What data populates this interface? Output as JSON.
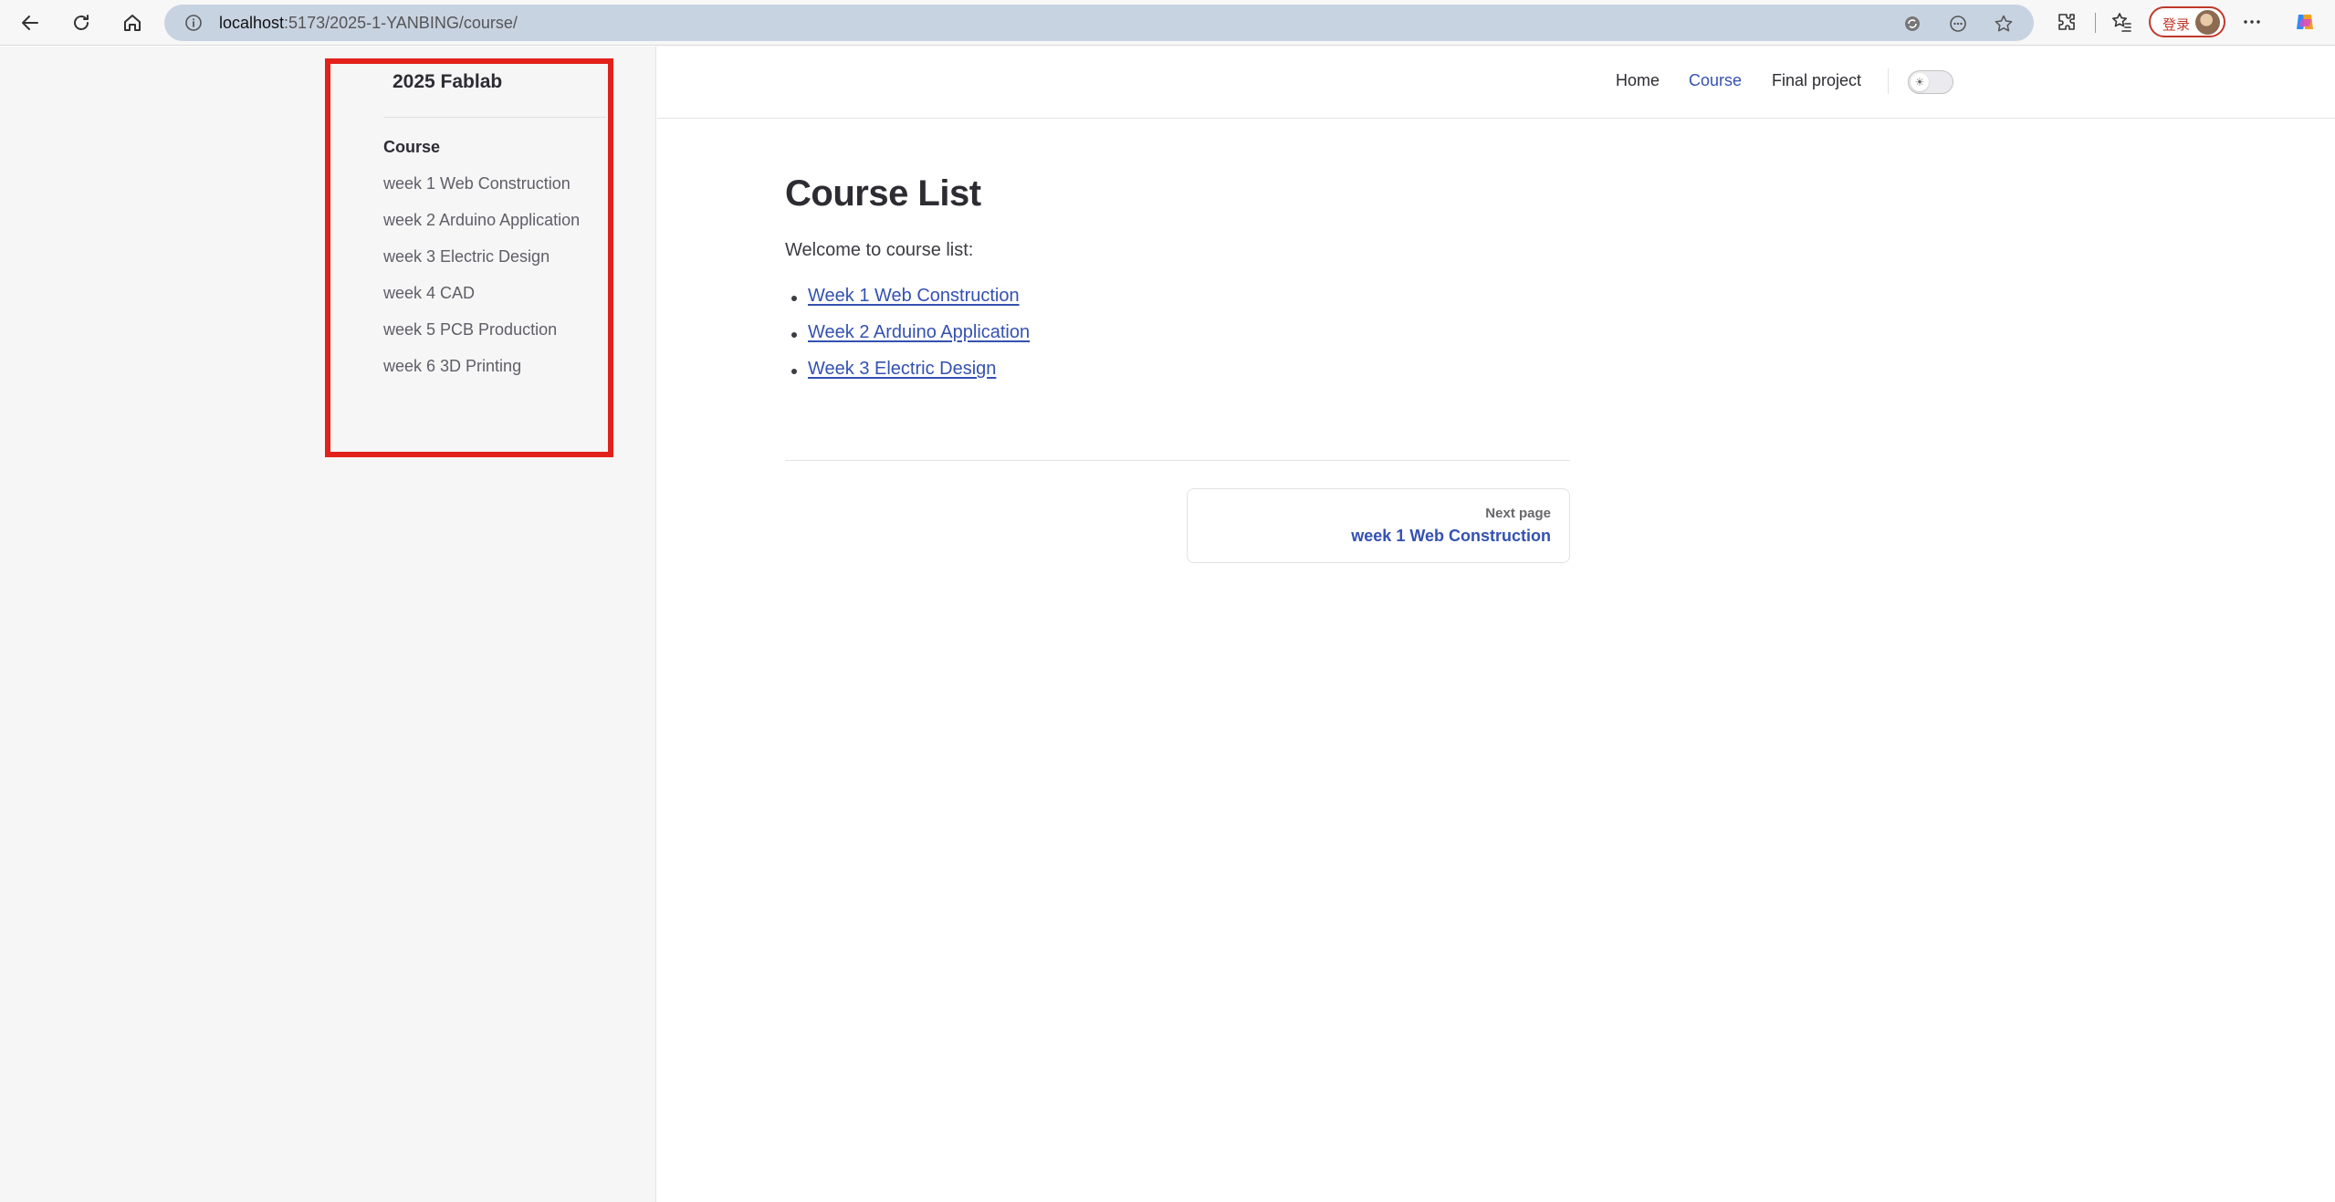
{
  "browser": {
    "url_host": "localhost",
    "url_path": ":5173/2025-1-YANBING/course/",
    "login_label": "登录"
  },
  "sidebar": {
    "site_title": "2025 Fablab",
    "section_title": "Course",
    "items": [
      {
        "label": "week 1 Web Construction"
      },
      {
        "label": "week 2 Arduino Application"
      },
      {
        "label": "week 3 Electric Design"
      },
      {
        "label": "week 4 CAD"
      },
      {
        "label": "week 5 PCB Production"
      },
      {
        "label": "week 6 3D Printing"
      }
    ],
    "highlight_color": "#e2211b"
  },
  "topnav": {
    "items": [
      {
        "label": "Home",
        "active": false
      },
      {
        "label": "Course",
        "active": true
      },
      {
        "label": "Final project",
        "active": false
      }
    ],
    "accent_color": "#3451b2"
  },
  "content": {
    "title": "Course List",
    "intro": "Welcome to course list:",
    "links": [
      {
        "label": "Week 1 Web Construction"
      },
      {
        "label": "Week 2 Arduino Application"
      },
      {
        "label": "Week 3 Electric Design"
      }
    ],
    "next": {
      "label": "Next page",
      "title": "week 1 Web Construction"
    }
  }
}
